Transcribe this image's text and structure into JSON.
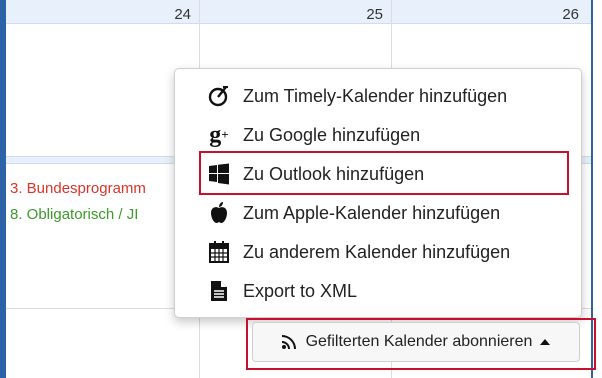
{
  "calendar": {
    "days": [
      "24",
      "25",
      "26"
    ],
    "events": [
      {
        "label": "3. Bundesprogramm",
        "color": "#d9342b"
      },
      {
        "label": "8. Obligatorisch / JI",
        "color": "#3a9b2a"
      }
    ]
  },
  "menu": {
    "items": [
      {
        "label": "Zum Timely-Kalender hinzufügen",
        "icon": "timely-icon"
      },
      {
        "label": "Zu Google hinzufügen",
        "icon": "google-plus-icon"
      },
      {
        "label": "Zu Outlook hinzufügen",
        "icon": "windows-icon"
      },
      {
        "label": "Zum Apple-Kalender hinzufügen",
        "icon": "apple-icon"
      },
      {
        "label": "Zu anderem Kalender hinzufügen",
        "icon": "calendar-icon"
      },
      {
        "label": "Export to XML",
        "icon": "document-icon"
      }
    ]
  },
  "subscribe": {
    "label": "Gefilterten Kalender abonnieren",
    "icon": "rss-icon",
    "caret": "caret-up-icon"
  },
  "colors": {
    "highlight": "#c8102e",
    "calendar_border": "#2b63a6",
    "header_bg": "#e8f1fb"
  }
}
